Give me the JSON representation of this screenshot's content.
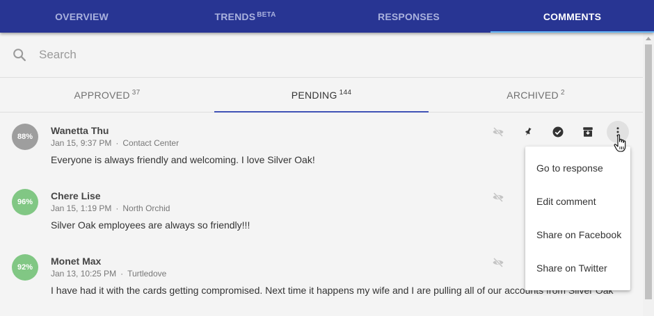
{
  "nav": {
    "tabs": [
      {
        "label": "OVERVIEW"
      },
      {
        "label": "TRENDS",
        "badge": "BETA"
      },
      {
        "label": "RESPONSES"
      },
      {
        "label": "COMMENTS"
      }
    ],
    "active": "COMMENTS"
  },
  "search": {
    "placeholder": "Search",
    "value": ""
  },
  "subtabs": [
    {
      "label": "APPROVED",
      "count": "37"
    },
    {
      "label": "PENDING",
      "count": "144"
    },
    {
      "label": "ARCHIVED",
      "count": "2"
    }
  ],
  "comments": [
    {
      "score": "88%",
      "score_color": "#9e9e9e",
      "name": "Wanetta Thu",
      "date": "Jan 15, 9:37 PM",
      "location": "Contact Center",
      "text": "Everyone is always friendly and welcoming. I love Silver Oak!"
    },
    {
      "score": "96%",
      "score_color": "#81c784",
      "name": "Chere Lise",
      "date": "Jan 15, 1:19 PM",
      "location": "North Orchid",
      "text": "Silver Oak employees are always so friendly!!!"
    },
    {
      "score": "92%",
      "score_color": "#81c784",
      "name": "Monet Max",
      "date": "Jan 13, 10:25 PM",
      "location": "Turtledove",
      "text": "I have had it with the cards getting compromised. Next time it happens my wife and I are pulling all of our accounts from Silver Oak"
    }
  ],
  "menu": {
    "items": [
      "Go to response",
      "Edit comment",
      "Share on Facebook",
      "Share on Twitter"
    ]
  },
  "colors": {
    "nav_bg": "#283593",
    "tab_indicator": "#3f51b5",
    "nav_indicator": "#64b5f6"
  },
  "icons": [
    "search-icon",
    "hide-icon",
    "pin-icon",
    "approve-icon",
    "archive-icon",
    "more-vert-icon",
    "hand-cursor-icon"
  ]
}
